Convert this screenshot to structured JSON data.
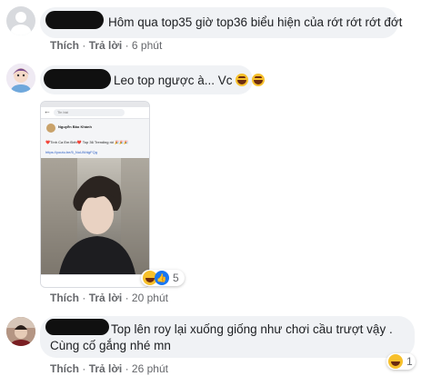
{
  "comments": [
    {
      "text": "Hôm qua top35 giờ top36 biểu hiện của rớt rớt rớt đớt",
      "like_label": "Thích",
      "reply_label": "Trả lời",
      "time": "6 phút"
    },
    {
      "text": "Leo top ngược à... Vc",
      "like_label": "Thích",
      "reply_label": "Trả lời",
      "time": "20 phút",
      "reaction_count": "5",
      "screenshot": {
        "author": "Nguyễn Bảo Khánh",
        "post_text": "❤️Tình Ca Em Đến❤️ Top 36 Trending rồi 🎉🎉🎉",
        "link": "https://youtu.be/5_NuUWdgFQg",
        "label": "Tin bài"
      }
    },
    {
      "text_line1": "Top lên roy lại xuống giống như chơi cầu trượt vậy .",
      "text_line2": "Cùng cố gắng nhé mn",
      "like_label": "Thích",
      "reply_label": "Trả lời",
      "time": "26 phút",
      "reaction_count": "1"
    }
  ],
  "separator": "·",
  "colors": {
    "bubble": "#f0f2f5",
    "meta": "#65676b",
    "like_blue": "#1877f2",
    "haha_yellow": "#f7c02b"
  }
}
